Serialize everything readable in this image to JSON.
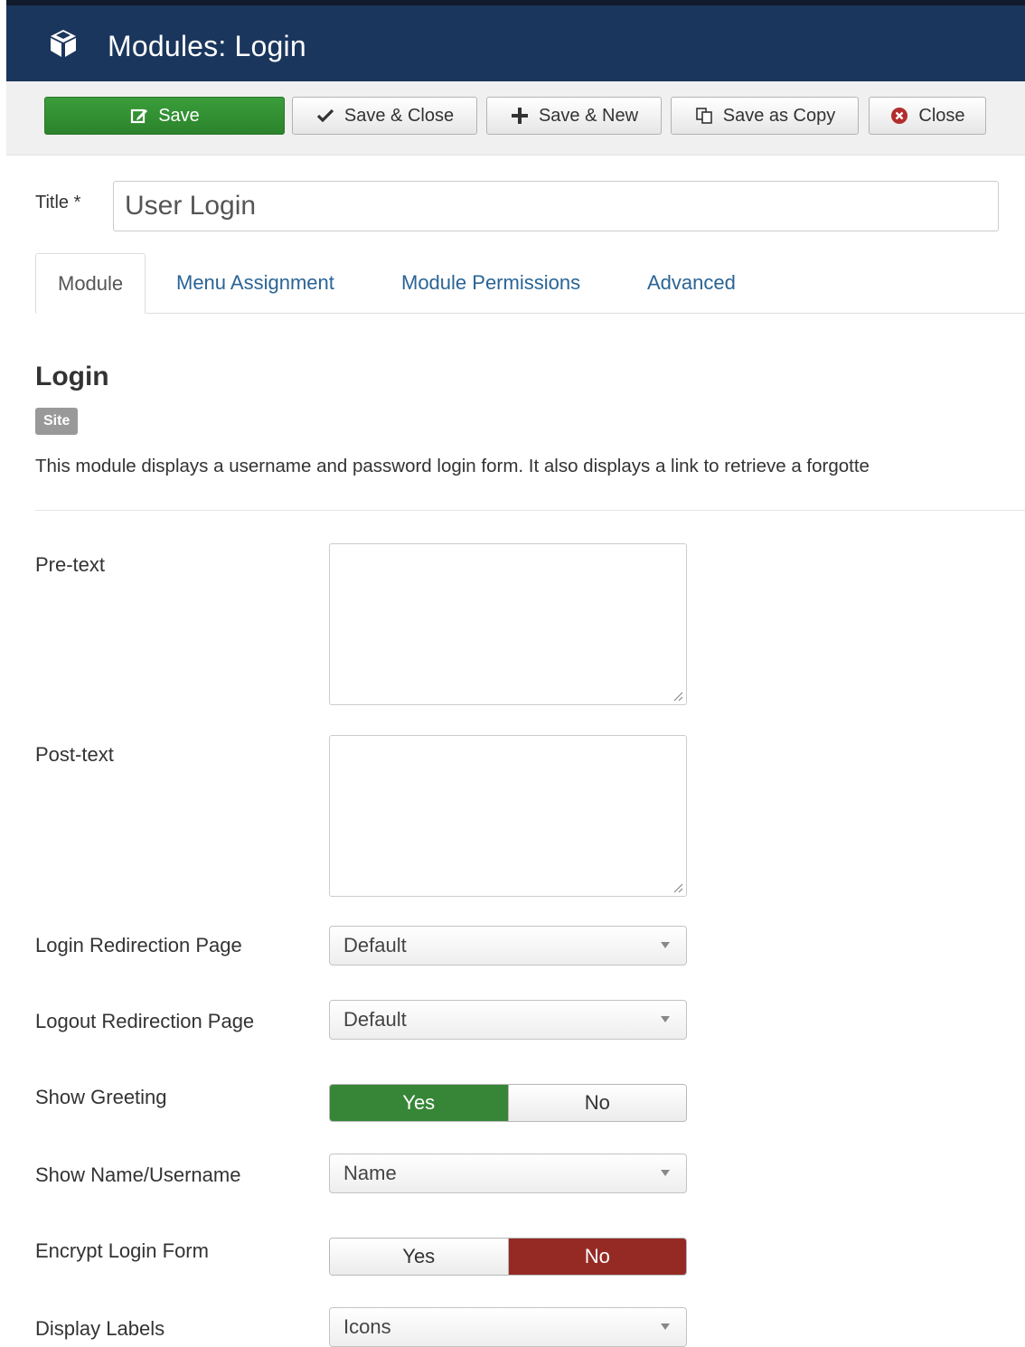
{
  "header": {
    "title": "Modules: Login",
    "icon": "cube-icon",
    "bg_color": "#1b365d"
  },
  "toolbar": {
    "save": "Save",
    "save_close": "Save & Close",
    "save_new": "Save & New",
    "save_copy": "Save as Copy",
    "close": "Close",
    "primary_color": "#2f8a2f"
  },
  "title_field": {
    "label": "Title *",
    "value": "User Login"
  },
  "tabs": [
    {
      "label": "Module",
      "active": true
    },
    {
      "label": "Menu Assignment",
      "active": false
    },
    {
      "label": "Module Permissions",
      "active": false
    },
    {
      "label": "Advanced",
      "active": false
    }
  ],
  "module": {
    "heading": "Login",
    "badge": "Site",
    "description": "This module displays a username and password login form. It also displays a link to retrieve a forgotte"
  },
  "fields": {
    "pretext": {
      "label": "Pre-text",
      "value": ""
    },
    "posttext": {
      "label": "Post-text",
      "value": ""
    },
    "login_redirect": {
      "label": "Login Redirection Page",
      "value": "Default"
    },
    "logout_redirect": {
      "label": "Logout Redirection Page",
      "value": "Default"
    },
    "show_greeting": {
      "label": "Show Greeting",
      "yes": "Yes",
      "no": "No",
      "selected": "Yes"
    },
    "show_name": {
      "label": "Show Name/Username",
      "value": "Name"
    },
    "encrypt": {
      "label": "Encrypt Login Form",
      "yes": "Yes",
      "no": "No",
      "selected": "No"
    },
    "display_labels": {
      "label": "Display Labels",
      "value": "Icons"
    }
  },
  "colors": {
    "yes_active": "#378537",
    "no_active": "#952a25",
    "link": "#2a6496"
  }
}
